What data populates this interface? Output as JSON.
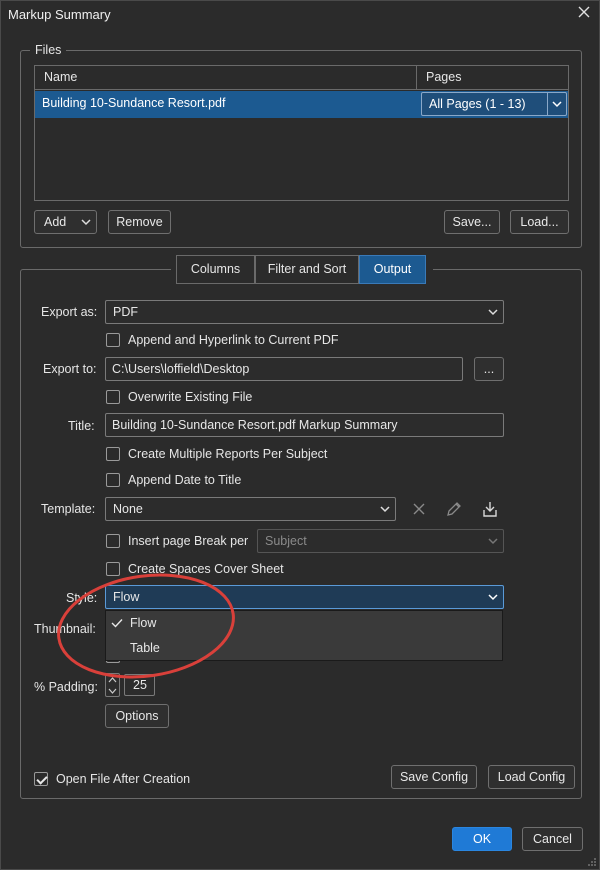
{
  "window": {
    "title": "Markup Summary"
  },
  "files": {
    "legend": "Files",
    "columns": {
      "name": "Name",
      "pages": "Pages"
    },
    "rows": [
      {
        "name": "Building 10-Sundance Resort.pdf",
        "pages": "All Pages (1 - 13)"
      }
    ],
    "add_label": "Add",
    "remove_label": "Remove",
    "save_label": "Save...",
    "load_label": "Load..."
  },
  "tabs": [
    {
      "label": "Columns",
      "active": false
    },
    {
      "label": "Filter and Sort",
      "active": false
    },
    {
      "label": "Output",
      "active": true
    }
  ],
  "output": {
    "export_as_label": "Export as:",
    "export_as_value": "PDF",
    "append_hyperlink_label": "Append and Hyperlink to Current PDF",
    "append_hyperlink_checked": false,
    "export_to_label": "Export to:",
    "export_to_value": "C:\\Users\\loffield\\Desktop",
    "browse_label": "...",
    "overwrite_label": "Overwrite Existing File",
    "overwrite_checked": false,
    "title_label": "Title:",
    "title_value": "Building 10-Sundance Resort.pdf Markup Summary",
    "multi_reports_label": "Create Multiple Reports Per Subject",
    "multi_reports_checked": false,
    "append_date_label": "Append Date to Title",
    "append_date_checked": false,
    "template_label": "Template:",
    "template_value": "None",
    "insert_break_label": "Insert page Break per",
    "insert_break_checked": false,
    "insert_break_value": "Subject",
    "spaces_cover_label": "Create Spaces Cover Sheet",
    "spaces_cover_checked": false,
    "style_label": "Style:",
    "style_value": "Flow",
    "style_options": [
      {
        "label": "Flow",
        "selected": true
      },
      {
        "label": "Table",
        "selected": false
      }
    ],
    "thumbnail_label": "Thumbnail:",
    "padding_label": "% Padding:",
    "padding_value": "25",
    "options_label": "Options",
    "open_after_label": "Open File After Creation",
    "open_after_checked": true,
    "save_config_label": "Save Config",
    "load_config_label": "Load Config"
  },
  "footer": {
    "ok_label": "OK",
    "cancel_label": "Cancel"
  },
  "colors": {
    "background": "#2b2b2b",
    "selection": "#1c5a91",
    "primary_button": "#1f7ad6",
    "annotation_circle": "#d9403a"
  }
}
